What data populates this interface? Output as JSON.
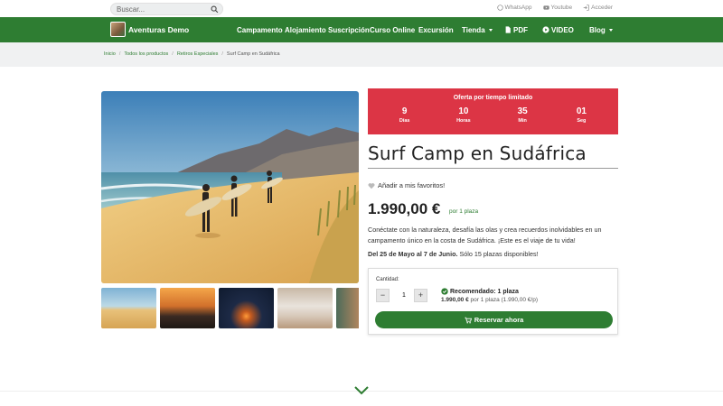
{
  "search": {
    "placeholder": "Buscar..."
  },
  "toplinks": {
    "whatsapp": "WhatsApp",
    "youtube": "Youtube",
    "login": "Acceder"
  },
  "brand": {
    "name": "Aventuras Demo"
  },
  "menu": {
    "items": [
      "Campamento",
      "Alojamiento",
      "Suscripción",
      "Curso Online",
      "Excursión",
      "Tienda",
      "PDF",
      "VIDEO",
      "Blog"
    ]
  },
  "breadcrumb": [
    "Inicio",
    "Todos los productos",
    "Retiros Especiales",
    "Surf Camp en Sudáfrica"
  ],
  "offer": {
    "title": "Oferta por tiempo limitado",
    "countdown": [
      {
        "value": "9",
        "label": "Días"
      },
      {
        "value": "10",
        "label": "Horas"
      },
      {
        "value": "35",
        "label": "Min"
      },
      {
        "value": "01",
        "label": "Seg"
      }
    ]
  },
  "product": {
    "title": "Surf Camp en Sudáfrica",
    "favorite_label": "Añadir a mis favoritos!",
    "price": "1.990,00 €",
    "price_unit": "por 1 plaza",
    "description": "Conéctate con la naturaleza, desafía las olas y crea recuerdos inolvidables en un campamento único en la costa de Sudáfrica. ¡Este es el viaje de tu vida!",
    "dates_strong": "Del 25 de Mayo al 7 de Junio.",
    "dates_rest": " Sólo 15 plazas disponibles!"
  },
  "booking": {
    "quantity_label": "Cantidad:",
    "quantity_value": "1",
    "minus": "−",
    "plus": "+",
    "recommended": "Recomendado: 1 plaza",
    "reco_price": "1.990,00 €",
    "reco_rest": " por 1 plaza (1.990,00 €/p)",
    "reserve_label": "Reservar ahora"
  },
  "colors": {
    "brand_green": "#2e7d32",
    "offer_red": "#dc3545"
  },
  "icons": [
    "search-icon",
    "whatsapp-icon",
    "youtube-icon",
    "login-icon",
    "pdf-icon",
    "play-icon",
    "heart-icon",
    "check-circle-icon",
    "cart-icon",
    "chevron-down-icon"
  ]
}
